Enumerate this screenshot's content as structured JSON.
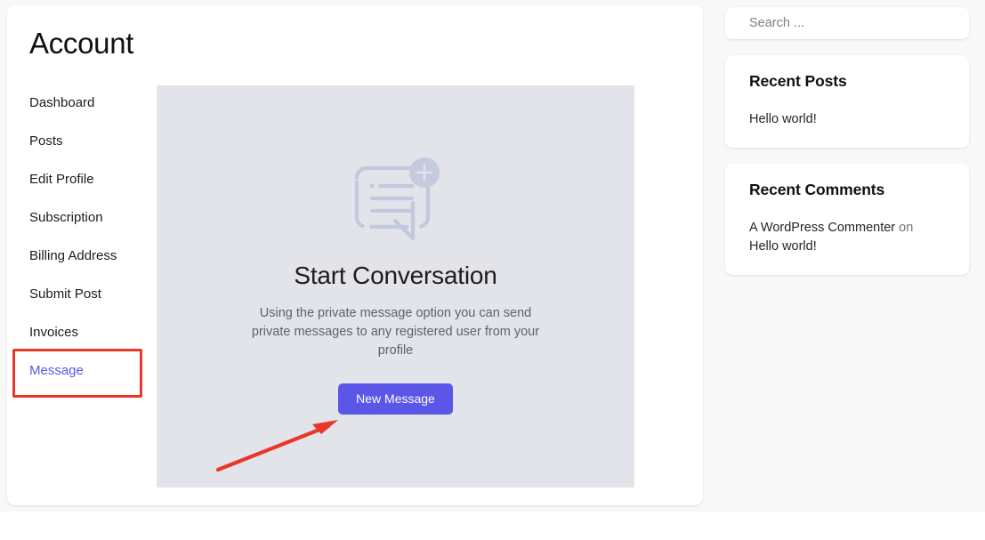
{
  "account": {
    "title": "Account",
    "nav": [
      {
        "label": "Dashboard",
        "active": false
      },
      {
        "label": "Posts",
        "active": false
      },
      {
        "label": "Edit Profile",
        "active": false
      },
      {
        "label": "Subscription",
        "active": false
      },
      {
        "label": "Billing Address",
        "active": false
      },
      {
        "label": "Submit Post",
        "active": false
      },
      {
        "label": "Invoices",
        "active": false
      },
      {
        "label": "Message",
        "active": true
      }
    ]
  },
  "conversation": {
    "icon": "new-message-bubble-icon",
    "badge_icon": "plus-circle-icon",
    "title": "Start Conversation",
    "description": "Using the private message option you can send private messages to any registered user from your profile",
    "button_label": "New Message"
  },
  "annotations": {
    "highlight_target": "Message",
    "arrow_target": "New Message",
    "color": "#e8362a"
  },
  "sidebar": {
    "search": {
      "placeholder": "Search ...",
      "value": ""
    },
    "recent_posts": {
      "title": "Recent Posts",
      "items": [
        {
          "label": "Hello world!"
        }
      ]
    },
    "recent_comments": {
      "title": "Recent Comments",
      "items": [
        {
          "author": "A WordPress Commenter",
          "separator": "on",
          "post": "Hello world!"
        }
      ]
    }
  },
  "colors": {
    "accent": "#5b56e8",
    "panel": "#e3e4e9",
    "annotation": "#e8362a",
    "page_bg": "#f8f8f9"
  }
}
